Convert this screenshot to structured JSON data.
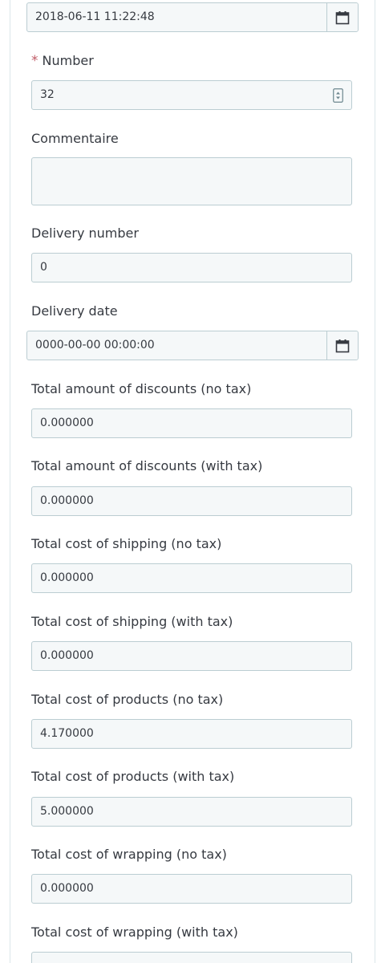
{
  "fields": {
    "date_add": {
      "value": "2018-06-11 11:22:48",
      "icon": "calendar-icon"
    },
    "number": {
      "required_mark": "*",
      "label": "Number",
      "value": "32",
      "icon": "spinner-icon"
    },
    "commentaire": {
      "label": "Commentaire",
      "value": ""
    },
    "delivery_number": {
      "label": "Delivery number",
      "value": "0"
    },
    "delivery_date": {
      "label": "Delivery date",
      "value": "0000-00-00 00:00:00",
      "icon": "calendar-icon"
    },
    "total_discounts_tax_excl": {
      "label": "Total amount of discounts (no tax)",
      "value": "0.000000"
    },
    "total_discounts_tax_incl": {
      "label": "Total amount of discounts (with tax)",
      "value": "0.000000"
    },
    "total_shipping_tax_excl": {
      "label": "Total cost of shipping (no tax)",
      "value": "0.000000"
    },
    "total_shipping_tax_incl": {
      "label": "Total cost of shipping (with tax)",
      "value": "0.000000"
    },
    "total_products": {
      "label": "Total cost of products (no tax)",
      "value": "4.170000"
    },
    "total_products_wt": {
      "label": "Total cost of products (with tax)",
      "value": "5.000000"
    },
    "total_wrapping_tax_excl": {
      "label": "Total cost of wrapping (no tax)",
      "value": "0.000000"
    },
    "total_wrapping_tax_incl": {
      "label": "Total cost of wrapping (with tax)",
      "value": ""
    }
  },
  "colors": {
    "input_background": "#f5f8f9",
    "input_border": "#bbcdd2",
    "required_mark": "#c05c67",
    "text": "#363a41"
  }
}
